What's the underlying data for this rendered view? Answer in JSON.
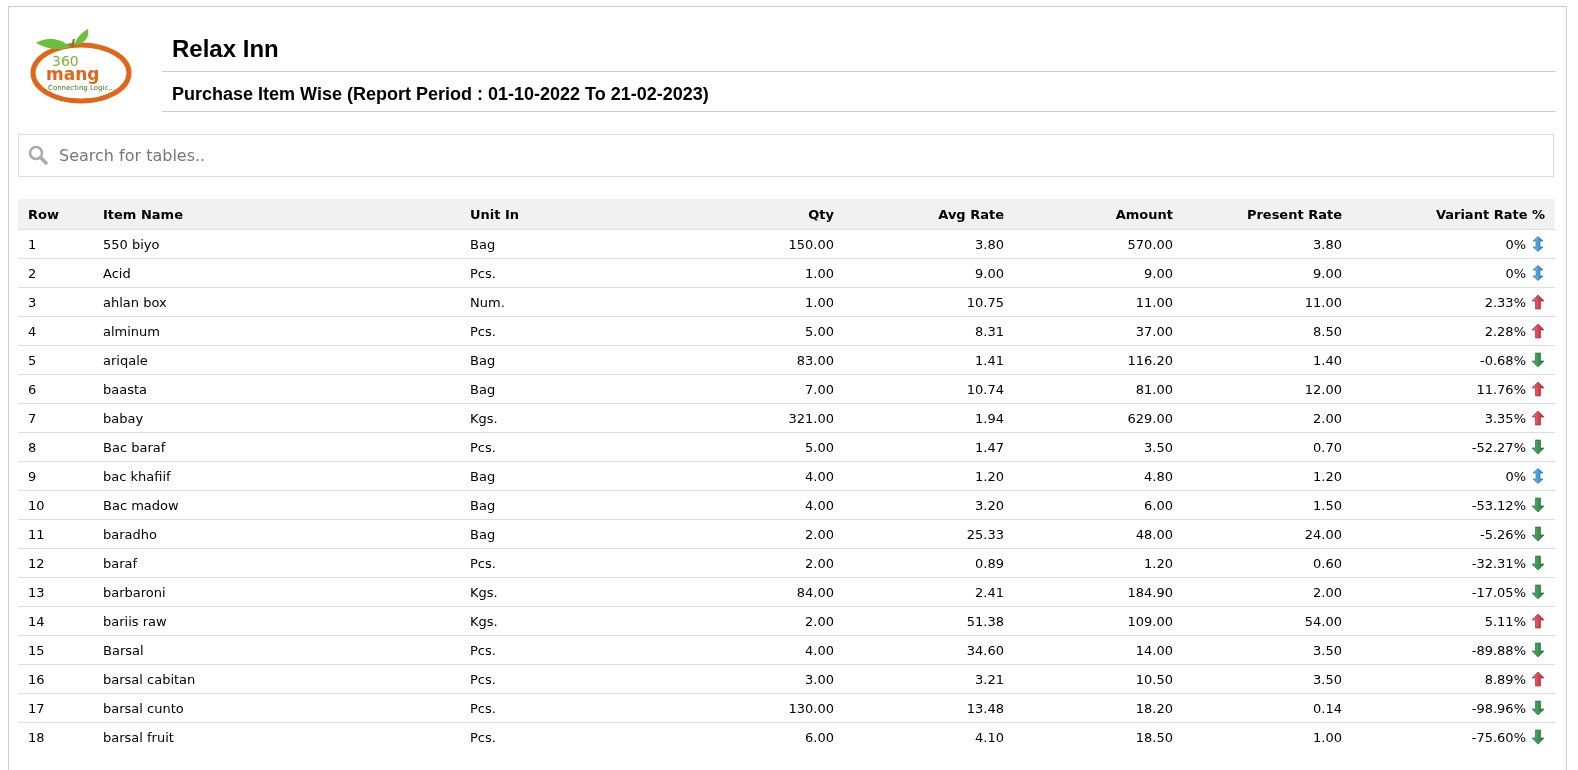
{
  "logo": {
    "number": "360",
    "word": "mang",
    "tagline": "Connecting Logic..."
  },
  "title": "Relax Inn",
  "subtitle": "Purchase Item Wise (Report Period : 01-10-2022 To 21-02-2023)",
  "search": {
    "placeholder": "Search for tables.."
  },
  "table": {
    "columns": [
      "Row",
      "Item Name",
      "Unit In",
      "Qty",
      "Avg Rate",
      "Amount",
      "Present Rate",
      "Variant Rate %"
    ],
    "rows": [
      {
        "row": "1",
        "item": "550 biyo",
        "unit": "Bag",
        "qty": "150.00",
        "avg_rate": "3.80",
        "amount": "570.00",
        "present_rate": "3.80",
        "variant": "0%",
        "kind": "same"
      },
      {
        "row": "2",
        "item": "Acid",
        "unit": "Pcs.",
        "qty": "1.00",
        "avg_rate": "9.00",
        "amount": "9.00",
        "present_rate": "9.00",
        "variant": "0%",
        "kind": "same"
      },
      {
        "row": "3",
        "item": "ahlan box",
        "unit": "Num.",
        "qty": "1.00",
        "avg_rate": "10.75",
        "amount": "11.00",
        "present_rate": "11.00",
        "variant": "2.33%",
        "kind": "up"
      },
      {
        "row": "4",
        "item": "alminum",
        "unit": "Pcs.",
        "qty": "5.00",
        "avg_rate": "8.31",
        "amount": "37.00",
        "present_rate": "8.50",
        "variant": "2.28%",
        "kind": "up"
      },
      {
        "row": "5",
        "item": "ariqale",
        "unit": "Bag",
        "qty": "83.00",
        "avg_rate": "1.41",
        "amount": "116.20",
        "present_rate": "1.40",
        "variant": "-0.68%",
        "kind": "down"
      },
      {
        "row": "6",
        "item": "baasta",
        "unit": "Bag",
        "qty": "7.00",
        "avg_rate": "10.74",
        "amount": "81.00",
        "present_rate": "12.00",
        "variant": "11.76%",
        "kind": "up"
      },
      {
        "row": "7",
        "item": "babay",
        "unit": "Kgs.",
        "qty": "321.00",
        "avg_rate": "1.94",
        "amount": "629.00",
        "present_rate": "2.00",
        "variant": "3.35%",
        "kind": "up"
      },
      {
        "row": "8",
        "item": "Bac baraf",
        "unit": "Pcs.",
        "qty": "5.00",
        "avg_rate": "1.47",
        "amount": "3.50",
        "present_rate": "0.70",
        "variant": "-52.27%",
        "kind": "down"
      },
      {
        "row": "9",
        "item": "bac khafiif",
        "unit": "Bag",
        "qty": "4.00",
        "avg_rate": "1.20",
        "amount": "4.80",
        "present_rate": "1.20",
        "variant": "0%",
        "kind": "same"
      },
      {
        "row": "10",
        "item": "Bac madow",
        "unit": "Bag",
        "qty": "4.00",
        "avg_rate": "3.20",
        "amount": "6.00",
        "present_rate": "1.50",
        "variant": "-53.12%",
        "kind": "down"
      },
      {
        "row": "11",
        "item": "baradho",
        "unit": "Bag",
        "qty": "2.00",
        "avg_rate": "25.33",
        "amount": "48.00",
        "present_rate": "24.00",
        "variant": "-5.26%",
        "kind": "down"
      },
      {
        "row": "12",
        "item": "baraf",
        "unit": "Pcs.",
        "qty": "2.00",
        "avg_rate": "0.89",
        "amount": "1.20",
        "present_rate": "0.60",
        "variant": "-32.31%",
        "kind": "down"
      },
      {
        "row": "13",
        "item": "barbaroni",
        "unit": "Kgs.",
        "qty": "84.00",
        "avg_rate": "2.41",
        "amount": "184.90",
        "present_rate": "2.00",
        "variant": "-17.05%",
        "kind": "down"
      },
      {
        "row": "14",
        "item": "bariis raw",
        "unit": "Kgs.",
        "qty": "2.00",
        "avg_rate": "51.38",
        "amount": "109.00",
        "present_rate": "54.00",
        "variant": "5.11%",
        "kind": "up"
      },
      {
        "row": "15",
        "item": "Barsal",
        "unit": "Pcs.",
        "qty": "4.00",
        "avg_rate": "34.60",
        "amount": "14.00",
        "present_rate": "3.50",
        "variant": "-89.88%",
        "kind": "down"
      },
      {
        "row": "16",
        "item": "barsal cabitan",
        "unit": "Pcs.",
        "qty": "3.00",
        "avg_rate": "3.21",
        "amount": "10.50",
        "present_rate": "3.50",
        "variant": "8.89%",
        "kind": "up"
      },
      {
        "row": "17",
        "item": "barsal cunto",
        "unit": "Pcs.",
        "qty": "130.00",
        "avg_rate": "13.48",
        "amount": "18.20",
        "present_rate": "0.14",
        "variant": "-98.96%",
        "kind": "down"
      },
      {
        "row": "18",
        "item": "barsal fruit",
        "unit": "Pcs.",
        "qty": "6.00",
        "avg_rate": "4.10",
        "amount": "18.50",
        "present_rate": "1.00",
        "variant": "-75.60%",
        "kind": "down"
      }
    ]
  }
}
